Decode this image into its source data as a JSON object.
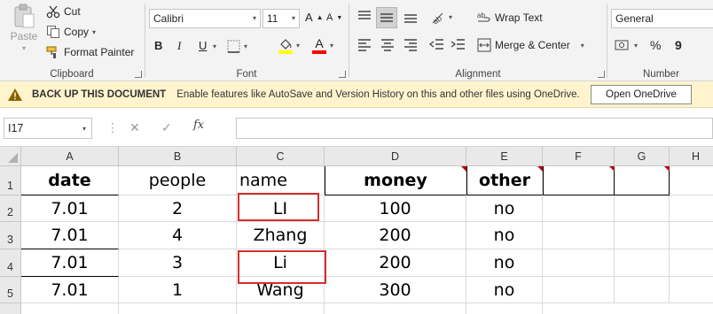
{
  "ribbon": {
    "clipboard": {
      "group_label": "Clipboard",
      "paste_label": "Paste",
      "cut_label": "Cut",
      "copy_label": "Copy",
      "format_painter_label": "Format Painter"
    },
    "font": {
      "group_label": "Font",
      "font_name": "Calibri",
      "font_size": "11",
      "bold": "B",
      "italic": "I",
      "underline": "U",
      "font_color_letter": "A",
      "highlight_color": "#ffff00",
      "font_color": "#ff0000"
    },
    "alignment": {
      "group_label": "Alignment",
      "wrap_text_label": "Wrap Text",
      "merge_center_label": "Merge & Center"
    },
    "number": {
      "group_label": "Number",
      "format": "General",
      "percent": "%",
      "comma": "9"
    }
  },
  "notice": {
    "title": "BACK UP THIS DOCUMENT",
    "message": "Enable features like AutoSave and Version History on this and other files using OneDrive.",
    "button": "Open OneDrive"
  },
  "formula_bar": {
    "name_box": "I17",
    "fx": "fx",
    "formula": ""
  },
  "sheet": {
    "columns": [
      "A",
      "B",
      "C",
      "D",
      "E",
      "F",
      "G",
      "H"
    ],
    "rows": [
      "1",
      "2",
      "3",
      "4",
      "5"
    ],
    "header_row": [
      "date",
      "people",
      "name",
      "money",
      "other"
    ],
    "data_rows": [
      [
        "7.01",
        "2",
        "LI",
        "100",
        "no"
      ],
      [
        "7.01",
        "4",
        "Zhang",
        "200",
        "no"
      ],
      [
        "7.01",
        "3",
        "Li",
        "200",
        "no"
      ],
      [
        "7.01",
        "1",
        "Wang",
        "300",
        "no"
      ]
    ],
    "comment_color": "#c00000",
    "highlight_box_color": "#d32f2f"
  }
}
